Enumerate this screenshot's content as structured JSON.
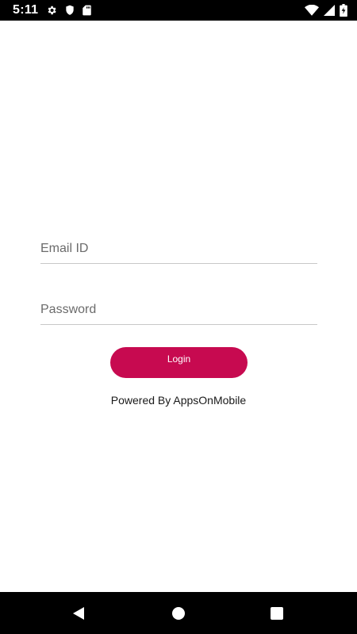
{
  "status_bar": {
    "time": "5:11",
    "left_icons": [
      "gear-icon",
      "shield-icon",
      "sd-card-icon"
    ],
    "right_icons": [
      "wifi-icon",
      "cell-signal-icon",
      "battery-charging-icon"
    ]
  },
  "login_form": {
    "email_placeholder": "Email ID",
    "email_value": "",
    "password_placeholder": "Password",
    "password_value": "",
    "login_label": "Login",
    "login_color": "#c70a50"
  },
  "footer": {
    "powered_by": "Powered By AppsOnMobile"
  },
  "nav_bar": {
    "icons": [
      "back-icon",
      "home-icon",
      "recents-icon"
    ]
  }
}
